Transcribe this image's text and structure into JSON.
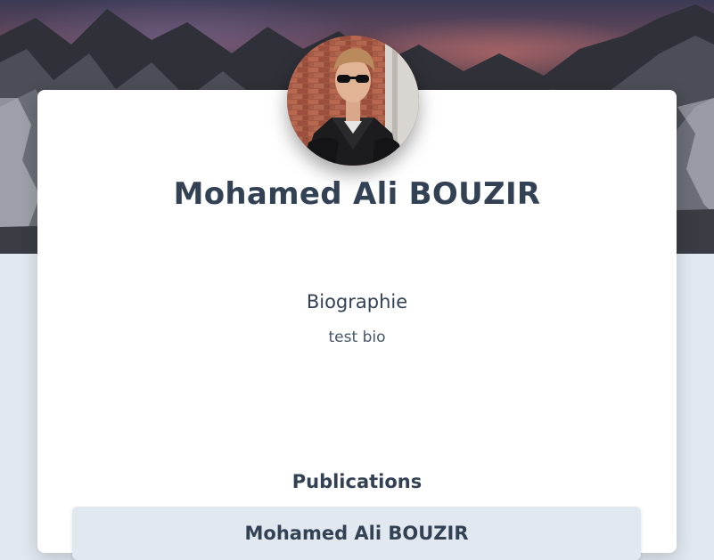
{
  "profile": {
    "name": "Mohamed Ali BOUZIR",
    "avatar_icon": "user-avatar-photo"
  },
  "biography": {
    "title": "Biographie",
    "text": "test bio"
  },
  "publications": {
    "title": "Publications",
    "items": [
      {
        "author": "Mohamed Ali BOUZIR"
      }
    ]
  },
  "colors": {
    "page_background": "#e2e8f0",
    "card_background": "#ffffff",
    "heading_text": "#334155",
    "publication_item_background": "#e2e8f0"
  }
}
